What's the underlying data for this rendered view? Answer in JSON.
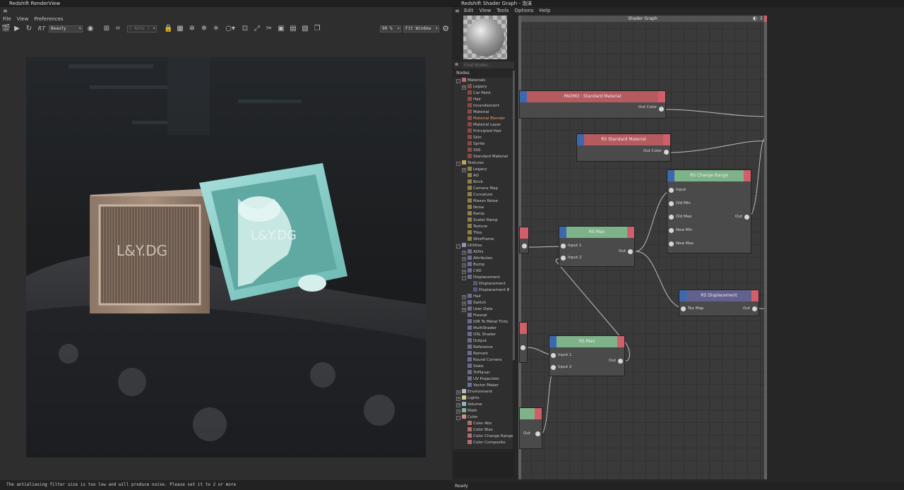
{
  "render_view": {
    "title": "Redshift RenderView",
    "menu": [
      "File",
      "View",
      "Preferences"
    ],
    "toolbar": {
      "rt_label": "RT",
      "aov_select": "Beauty",
      "size_select": "( Auto )",
      "zoom": "90 %",
      "fit_select": "Fit Window"
    },
    "render": {
      "left_cube_text": "L&Y.DG",
      "right_cube_text": "L&Y.DG"
    },
    "status": "The antialiasing filter size is too low and will produce noise. Please set it to 2 or more"
  },
  "shader_graph": {
    "title": "Redshift Shader Graph - 泡沫",
    "menu": [
      "Edit",
      "View",
      "Tools",
      "Options",
      "Help"
    ],
    "find_placeholder": "Find Nodes...",
    "nodes_title": "Nodes",
    "graph_title": "Shader Graph",
    "status": "Ready",
    "tree": [
      {
        "label": "Materials",
        "lvl": 0,
        "exp": "-",
        "color": "#b56b6b"
      },
      {
        "label": "Legacy",
        "lvl": 1,
        "exp": "+",
        "color": "#8a4a4a"
      },
      {
        "label": "Car Paint",
        "lvl": 1,
        "color": "#8a4a4a"
      },
      {
        "label": "Hair",
        "lvl": 1,
        "color": "#8a4a4a"
      },
      {
        "label": "Incandescent",
        "lvl": 1,
        "color": "#8a4a4a"
      },
      {
        "label": "Material",
        "lvl": 1,
        "color": "#8a4a4a"
      },
      {
        "label": "Material Blender",
        "lvl": 1,
        "color": "#8a4a4a",
        "highlight": true
      },
      {
        "label": "Material Layer",
        "lvl": 1,
        "color": "#8a4a4a"
      },
      {
        "label": "Principled Hair",
        "lvl": 1,
        "color": "#8a4a4a"
      },
      {
        "label": "Skin",
        "lvl": 1,
        "color": "#8a4a4a"
      },
      {
        "label": "Sprite",
        "lvl": 1,
        "color": "#8a4a4a"
      },
      {
        "label": "SSS",
        "lvl": 1,
        "color": "#8a4a4a"
      },
      {
        "label": "Standard Material",
        "lvl": 1,
        "color": "#8a4a4a"
      },
      {
        "label": "Textures",
        "lvl": 0,
        "exp": "-",
        "color": "#bca65e"
      },
      {
        "label": "Legacy",
        "lvl": 1,
        "exp": "+",
        "color": "#8f7f45"
      },
      {
        "label": "AO",
        "lvl": 1,
        "color": "#8f7f45"
      },
      {
        "label": "Brick",
        "lvl": 1,
        "color": "#8f7f45"
      },
      {
        "label": "Camera Map",
        "lvl": 1,
        "color": "#8f7f45"
      },
      {
        "label": "Curvature",
        "lvl": 1,
        "color": "#8f7f45"
      },
      {
        "label": "Maxon Noise",
        "lvl": 1,
        "color": "#8f7f45"
      },
      {
        "label": "Noise",
        "lvl": 1,
        "color": "#8f7f45"
      },
      {
        "label": "Ramp",
        "lvl": 1,
        "color": "#8f7f45"
      },
      {
        "label": "Scalar Ramp",
        "lvl": 1,
        "color": "#8f7f45"
      },
      {
        "label": "Texture",
        "lvl": 1,
        "color": "#8f7f45"
      },
      {
        "label": "Tiles",
        "lvl": 1,
        "color": "#8f7f45"
      },
      {
        "label": "WireFrame",
        "lvl": 1,
        "color": "#8f7f45"
      },
      {
        "label": "Utilities",
        "lvl": 0,
        "exp": "-",
        "color": "#8d8fb5"
      },
      {
        "label": "AOVs",
        "lvl": 1,
        "exp": "+",
        "color": "#6a6c90"
      },
      {
        "label": "Attributes",
        "lvl": 1,
        "exp": "+",
        "color": "#6a6c90"
      },
      {
        "label": "Bump",
        "lvl": 1,
        "exp": "+",
        "color": "#6a6c90"
      },
      {
        "label": "C4D",
        "lvl": 1,
        "exp": "+",
        "color": "#6a6c90"
      },
      {
        "label": "Displacement",
        "lvl": 1,
        "exp": "-",
        "color": "#6a6c90"
      },
      {
        "label": "Displacement",
        "lvl": 2,
        "color": "#55577a"
      },
      {
        "label": "Displacement B",
        "lvl": 2,
        "color": "#55577a"
      },
      {
        "label": "Hair",
        "lvl": 1,
        "exp": "+",
        "color": "#6a6c90"
      },
      {
        "label": "Switch",
        "lvl": 1,
        "exp": "+",
        "color": "#6a6c90"
      },
      {
        "label": "User Data",
        "lvl": 1,
        "exp": "+",
        "color": "#6a6c90"
      },
      {
        "label": "Fresnel",
        "lvl": 1,
        "color": "#6a6c90"
      },
      {
        "label": "IOR To Metal Tints",
        "lvl": 1,
        "color": "#6a6c90"
      },
      {
        "label": "MultiShader",
        "lvl": 1,
        "color": "#6a6c90"
      },
      {
        "label": "OSL Shader",
        "lvl": 1,
        "color": "#6a6c90"
      },
      {
        "label": "Output",
        "lvl": 1,
        "color": "#6a6c90"
      },
      {
        "label": "Reference",
        "lvl": 1,
        "color": "#6a6c90"
      },
      {
        "label": "Remark",
        "lvl": 1,
        "color": "#6a6c90"
      },
      {
        "label": "Round Corners",
        "lvl": 1,
        "color": "#6a6c90"
      },
      {
        "label": "State",
        "lvl": 1,
        "color": "#6a6c90"
      },
      {
        "label": "TriPlanar",
        "lvl": 1,
        "color": "#6a6c90"
      },
      {
        "label": "UV Projection",
        "lvl": 1,
        "color": "#6a6c90"
      },
      {
        "label": "Vector Maker",
        "lvl": 1,
        "color": "#6a6c90"
      },
      {
        "label": "Environment",
        "lvl": 0,
        "exp": "+",
        "color": "#b8b8b8"
      },
      {
        "label": "Lights",
        "lvl": 0,
        "exp": "+",
        "color": "#d6cf8a"
      },
      {
        "label": "Volume",
        "lvl": 0,
        "exp": "+",
        "color": "#8fb0d0"
      },
      {
        "label": "Math",
        "lvl": 0,
        "exp": "+",
        "color": "#7fb68a"
      },
      {
        "label": "Color",
        "lvl": 0,
        "exp": "-",
        "color": "#d08a8a"
      },
      {
        "label": "Color Abs",
        "lvl": 1,
        "color": "#b46b6b"
      },
      {
        "label": "Color Bias",
        "lvl": 1,
        "color": "#b46b6b"
      },
      {
        "label": "Color Change Range",
        "lvl": 1,
        "color": "#b46b6b"
      },
      {
        "label": "Color Composite",
        "lvl": 1,
        "color": "#b46b6b"
      }
    ],
    "nodes": {
      "paomo": {
        "title": "PAOMO : Standard Material",
        "out": "Out Color"
      },
      "rs_std": {
        "title": "RS Standard Material",
        "out": "Out Color"
      },
      "change_range": {
        "title": "RS Change Range",
        "inputs": [
          "Input",
          "Old Min",
          "Old Max",
          "New Min",
          "New Max"
        ],
        "out": "Out"
      },
      "max1": {
        "title": "RS Max",
        "inputs": [
          "Input 1",
          "Input 2"
        ],
        "out": "Out"
      },
      "max2": {
        "title": "RS Max",
        "inputs": [
          "Input 1",
          "Input 2"
        ],
        "out": "Out"
      },
      "disp": {
        "title": "RS Displacement",
        "inputs": [
          "Tex Map"
        ],
        "out": "Out"
      },
      "bottom": {
        "out": "Out"
      }
    },
    "colors": {
      "material": "#b55a5f",
      "utility": "#62608d",
      "math": "#7eb389",
      "input_port": "#3d68b0",
      "output_port": "#d05f6a"
    }
  }
}
